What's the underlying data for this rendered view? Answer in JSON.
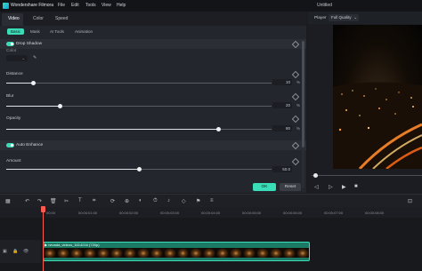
{
  "app": {
    "name": "Wondershare Filmora",
    "window_title": "Untitled"
  },
  "menu": [
    "File",
    "Edit",
    "Tools",
    "View",
    "Help"
  ],
  "top_tabs": [
    "Video",
    "Color",
    "Speed"
  ],
  "sub_tabs": [
    "Basic",
    "Mask",
    "AI Tools",
    "Animation"
  ],
  "sections": {
    "drop_shadow": "Drop Shadow",
    "color_label": "Color",
    "auto_enhance": "Auto Enhance"
  },
  "params": {
    "distance": {
      "label": "Distance",
      "value": "10",
      "unit": "%",
      "fraction": 0.1
    },
    "blur": {
      "label": "Blur",
      "value": "20",
      "unit": "%",
      "fraction": 0.2
    },
    "opacity": {
      "label": "Opacity",
      "value": "80",
      "unit": "%",
      "fraction": 0.8
    },
    "amount": {
      "label": "Amount",
      "value": "50.0",
      "fraction": 0.5
    }
  },
  "buttons": {
    "ok": "OK",
    "reset": "Reset"
  },
  "player": {
    "label": "Player",
    "quality": "Full Quality"
  },
  "ruler_ticks": [
    "00:00",
    "00:00:01:00",
    "00:00:02:00",
    "00:00:03:00",
    "00:00:04:00",
    "00:00:05:00",
    "00:00:06:00",
    "00:00:07:00",
    "00:00:08:00"
  ],
  "clip": {
    "title": "▶ nevada_videos_1614216 (720p)"
  },
  "colors": {
    "accent": "#39deb8",
    "playhead": "#ff5a4e"
  }
}
